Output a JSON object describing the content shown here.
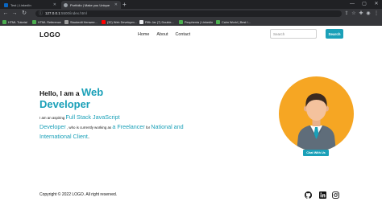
{
  "browser": {
    "tabs": [
      {
        "title": "Test | LinkedIn",
        "favicon_color": "#0a66c2",
        "active": false
      },
      {
        "title": "Portfolio | Make you Unique",
        "favicon_color": "#3c4043",
        "active": true
      }
    ],
    "new_tab_icon": "plus-icon",
    "window_controls": [
      "minimize-icon",
      "maximize-icon",
      "close-icon"
    ],
    "address": {
      "host": "127.0.0.1",
      "path": ":5500/index.html"
    },
    "bookmarks": [
      {
        "label": "HTML Tutorial",
        "color": "#4caf50"
      },
      {
        "label": "HTML Reference",
        "color": "#4caf50"
      },
      {
        "label": "Stackedit Henwee...",
        "color": "#9e9e9e"
      },
      {
        "label": "(32) Web Developm...",
        "color": "#ff0000"
      },
      {
        "label": "Fifth Jar (7) Double...",
        "color": "#e8eaed"
      },
      {
        "label": "Pexphenia | Linkedin",
        "color": "#4caf50"
      },
      {
        "label": "Calm World | Best I...",
        "color": "#4caf50"
      }
    ]
  },
  "page": {
    "logo": "LOGO",
    "nav": [
      "Home",
      "About",
      "Contact"
    ],
    "search": {
      "placeholder": "Search",
      "button": "Search"
    },
    "hero": {
      "hello": "Hello, I am a ",
      "role_word_1": "Web",
      "role_word_2": "Developer",
      "intro": "I am an aspiring ",
      "skill_1": "Full Stack JavaScript",
      "skill_2": "Developer",
      "mid": " , who is currently working as ",
      "article": "a ",
      "freelancer": "Freelancer",
      "for": " for ",
      "client_1": "National and",
      "client_2": "International Client",
      "end": "."
    },
    "chat_button": "Chat With Us",
    "footer": {
      "copyright": "Copyright © 2022 LOGO. All right reserved.",
      "social_icons": [
        "github-icon",
        "linkedin-icon",
        "instagram-icon"
      ]
    }
  },
  "colors": {
    "accent": "#1aa0b8",
    "avatar_bg": "#f6a623"
  }
}
